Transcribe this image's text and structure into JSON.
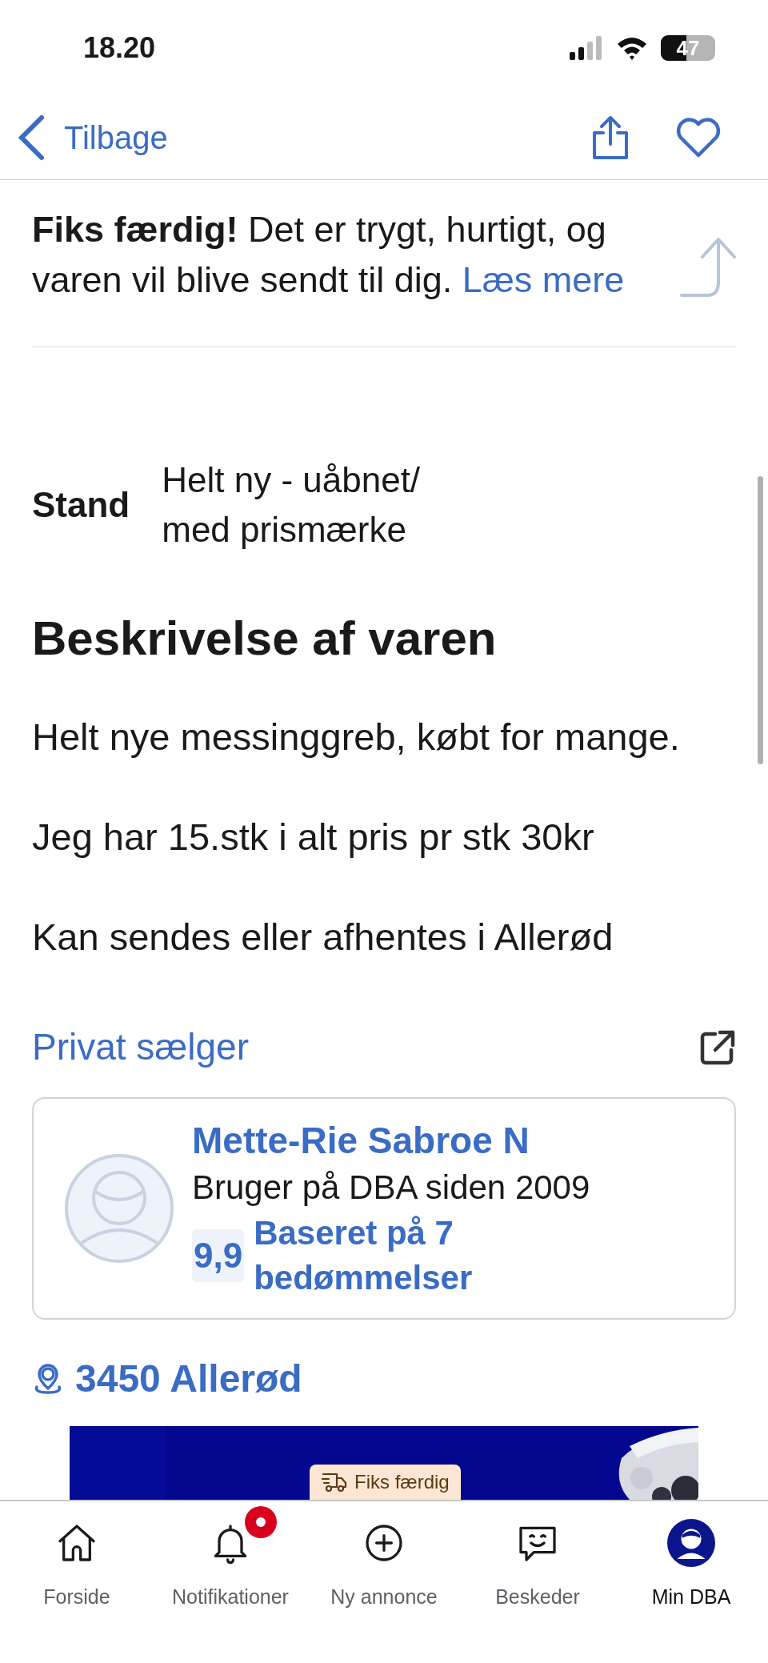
{
  "status_bar": {
    "time": "18.20",
    "battery": "47"
  },
  "header": {
    "back_label": "Tilbage"
  },
  "shipping_note": {
    "text": "**Fiks færdig!** Det er trygt, hurtigt, og varen vil blive sendt til dig.",
    "link": "Læs mere"
  },
  "condition": {
    "label": "Stand",
    "value": [
      "Helt ny - uåbnet/",
      "med prismærke"
    ]
  },
  "description": {
    "title": "Beskrivelse af varen",
    "paragraphs": [
      "Helt nye messinggreb, købt for mange.",
      "Jeg har 15.stk i alt pris pr stk 30kr",
      "Kan sendes eller afhentes i Allerød"
    ]
  },
  "seller": {
    "heading": "Privat sælger",
    "name": "Mette-Rie Sabroe N",
    "member_since": "Bruger på DBA siden 2009",
    "rating": "9,9",
    "rating_text": "Baseret på 7 bedømmelser"
  },
  "location": "3450 Allerød",
  "ad": {
    "kind": "picture",
    "badge": "Fiks færdig"
  },
  "bottom_nav": [
    {
      "label": "Forside",
      "selected": false,
      "badge": false
    },
    {
      "label": "Notifikationer",
      "selected": false,
      "badge": true
    },
    {
      "label": "Ny annonce",
      "selected": false,
      "badge": false
    },
    {
      "label": "Beskeder",
      "selected": false,
      "badge": false
    },
    {
      "label": "Min DBA",
      "selected": true,
      "badge": false
    }
  ]
}
